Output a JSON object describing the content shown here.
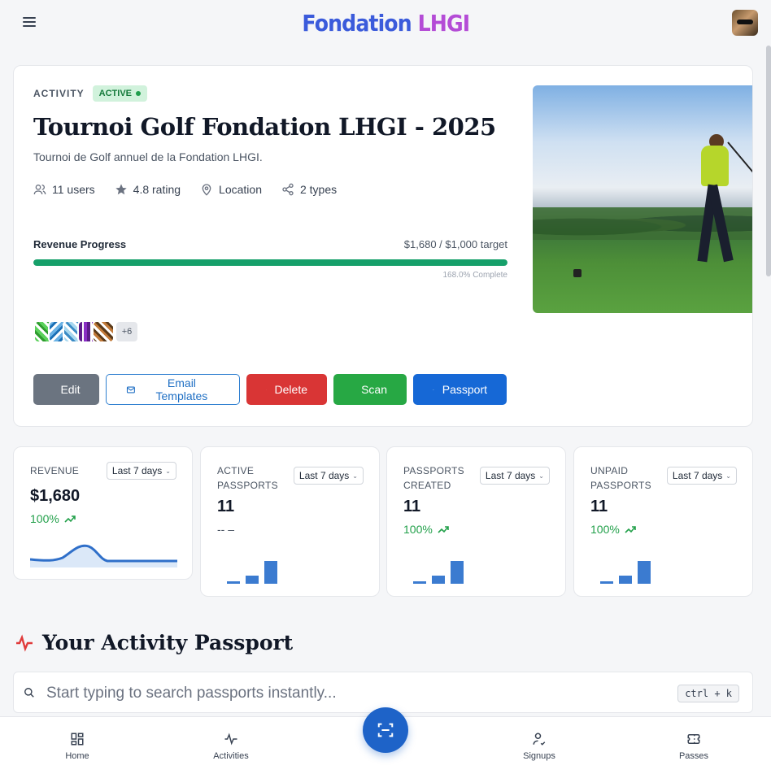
{
  "header": {
    "brand_part1": "Fondation",
    "brand_part2": "LHGI"
  },
  "activity": {
    "label": "ACTIVITY",
    "status": "ACTIVE",
    "title": "Tournoi Golf Fondation LHGI - 2025",
    "description": "Tournoi de Golf annuel de la Fondation LHGI.",
    "meta": {
      "users": "11 users",
      "rating": "4.8 rating",
      "location": "Location",
      "types": "2 types"
    },
    "revenue_label": "Revenue Progress",
    "revenue_value": "$1,680 / $1,000 target",
    "revenue_percent_note": "168.0% Complete",
    "revenue_progress_fraction": 1.0,
    "more_participants": "+6",
    "buttons": {
      "edit": "Edit",
      "email_templates": "Email Templates",
      "delete": "Delete",
      "scan": "Scan",
      "passport": "Passport"
    }
  },
  "stats": [
    {
      "label": "REVENUE",
      "range": "Last 7 days",
      "value": "$1,680",
      "delta": "100%"
    },
    {
      "label": "ACTIVE PASSPORTS",
      "range": "Last 7 days",
      "value": "11",
      "delta": "-- –",
      "bars": [
        1,
        3,
        8
      ]
    },
    {
      "label": "PASSPORTS CREATED",
      "range": "Last 7 days",
      "value": "11",
      "delta": "100%",
      "bars": [
        1,
        3,
        8
      ]
    },
    {
      "label": "UNPAID PASSPORTS",
      "range": "Last 7 days",
      "value": "11",
      "delta": "100%",
      "bars": [
        1,
        3,
        8
      ]
    }
  ],
  "passport_section": {
    "title": "Your Activity Passport",
    "search_placeholder": "Start typing to search passports instantly...",
    "shortcut": "ctrl + k"
  },
  "nav": {
    "home": "Home",
    "activities": "Activities",
    "signups": "Signups",
    "passes": "Passes"
  },
  "colors": {
    "accent": "#1668d6",
    "success": "#16a06a",
    "danger": "#d93535"
  }
}
